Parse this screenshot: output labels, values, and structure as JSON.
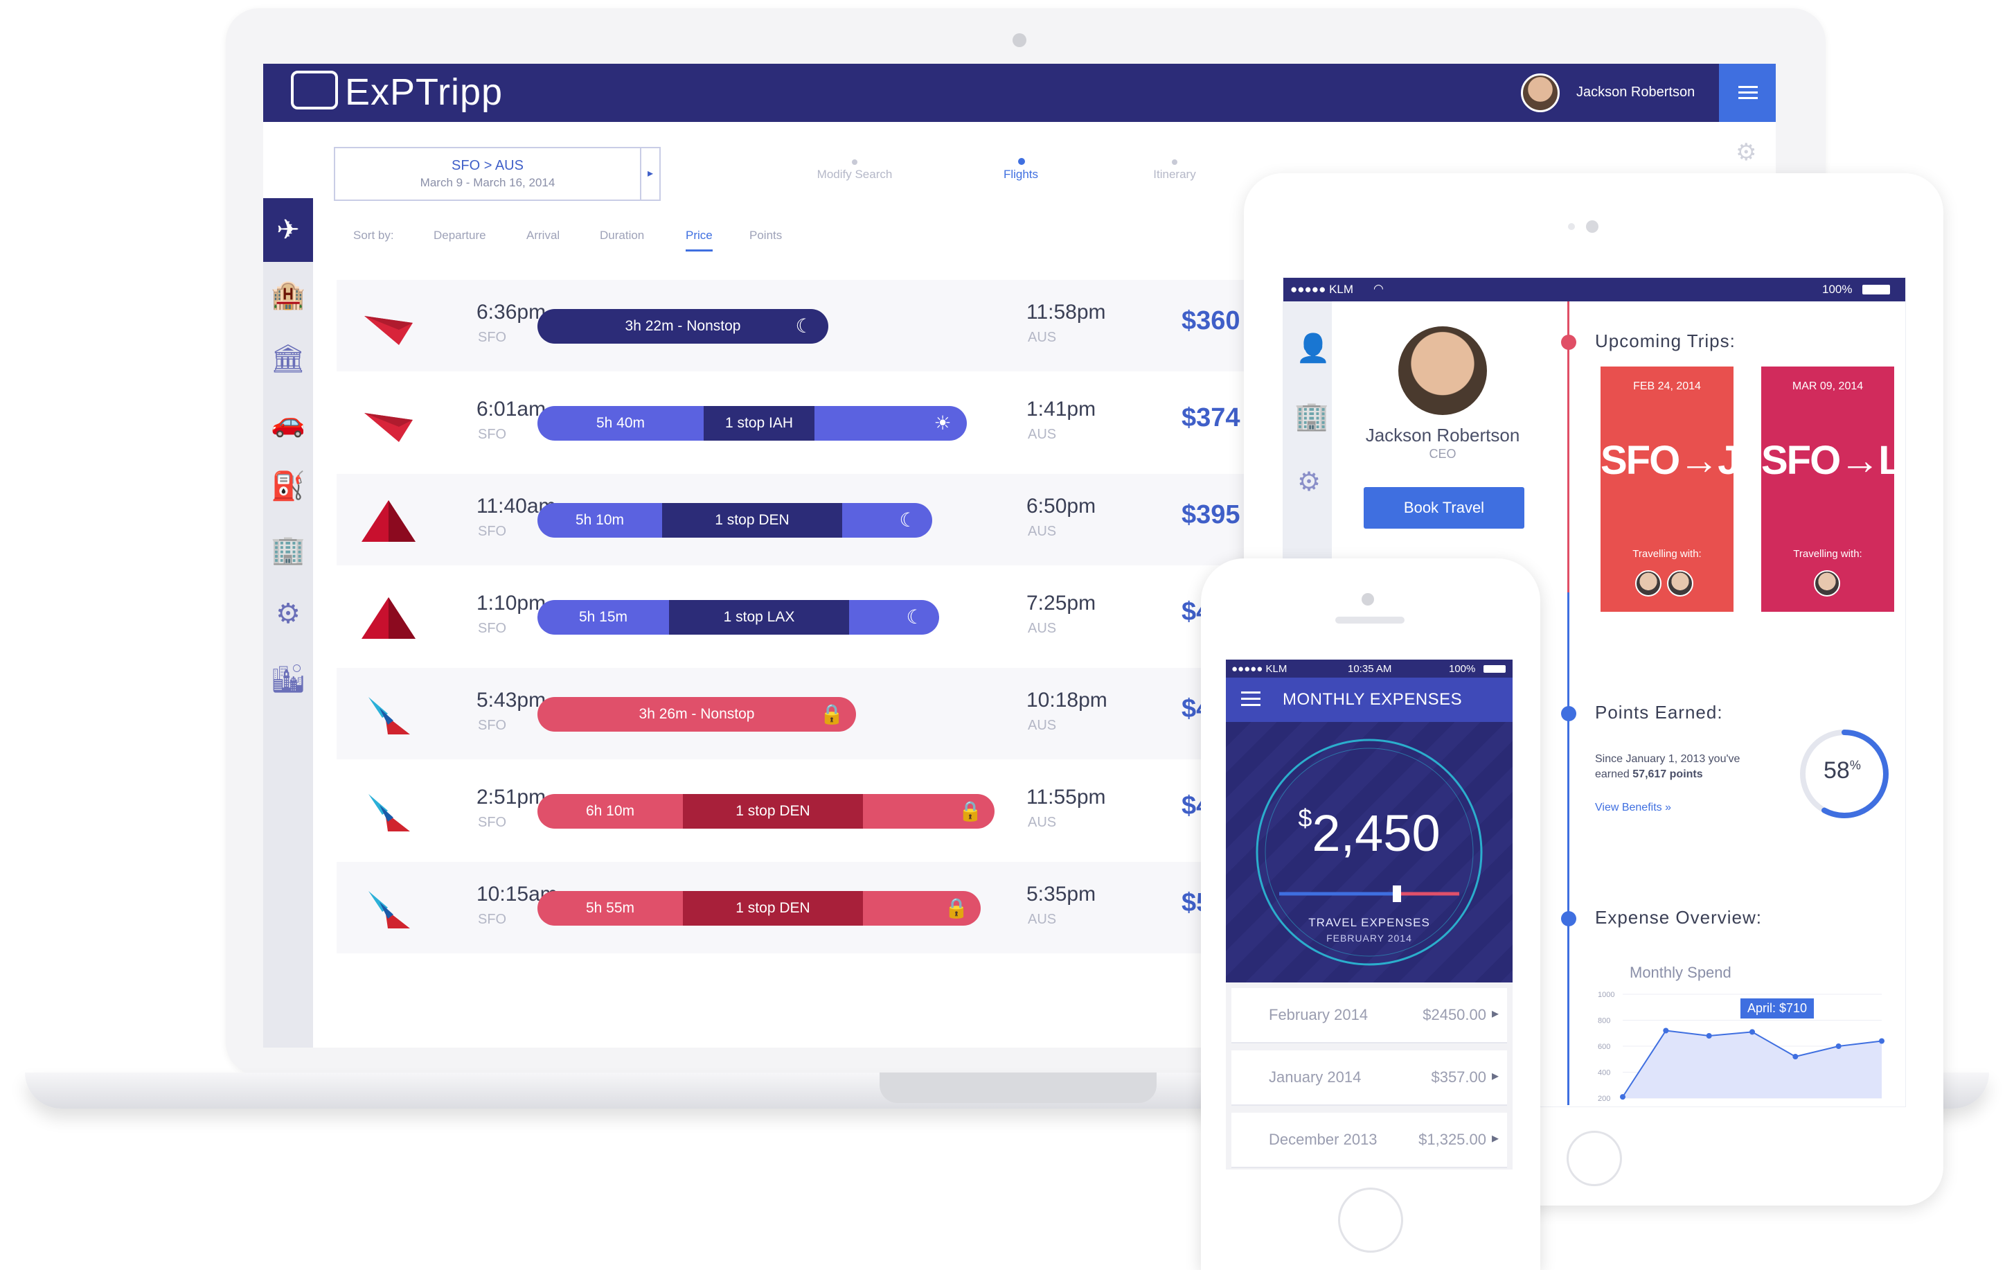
{
  "laptop": {
    "logo": "ExPTripp",
    "user_name": "Jackson Robertson",
    "route": {
      "main": "SFO > AUS",
      "dates": "March 9 - March 16, 2014"
    },
    "steps": [
      "Modify Search",
      "Flights",
      "Itinerary"
    ],
    "active_step": "Flights",
    "sort": {
      "label": "Sort by:",
      "options": [
        "Departure",
        "Arrival",
        "Duration",
        "Price",
        "Points"
      ],
      "active": "Price"
    },
    "flights": [
      {
        "airline": "Virgin America",
        "dep_time": "6:36pm",
        "dep_code": "SFO",
        "bar_segments": [
          "3h 22m - Nonstop"
        ],
        "icon": "moon-icon",
        "color": "#2c2c78",
        "arr_time": "11:58pm",
        "arr_code": "AUS",
        "price": "$360"
      },
      {
        "airline": "Virgin America",
        "dep_time": "6:01am",
        "dep_code": "SFO",
        "bar_segments": [
          "5h 40m",
          "1 stop IAH"
        ],
        "icon": "sun-icon",
        "color": "#5b62e0",
        "arr_time": "1:41pm",
        "arr_code": "AUS",
        "price": "$374"
      },
      {
        "airline": "Delta",
        "dep_time": "11:40am",
        "dep_code": "SFO",
        "bar_segments": [
          "5h 10m",
          "1 stop DEN"
        ],
        "icon": "moon-icon",
        "color": "#5b62e0",
        "arr_time": "6:50pm",
        "arr_code": "AUS",
        "price": "$395"
      },
      {
        "airline": "Delta",
        "dep_time": "1:10pm",
        "dep_code": "SFO",
        "bar_segments": [
          "5h 15m",
          "1 stop LAX"
        ],
        "icon": "moon-icon",
        "color": "#5b62e0",
        "arr_time": "7:25pm",
        "arr_code": "AUS",
        "price": "$4"
      },
      {
        "airline": "American",
        "dep_time": "5:43pm",
        "dep_code": "SFO",
        "bar_segments": [
          "3h 26m - Nonstop"
        ],
        "icon": "lock-icon",
        "color": "#e0506a",
        "arr_time": "10:18pm",
        "arr_code": "AUS",
        "price": "$4"
      },
      {
        "airline": "American",
        "dep_time": "2:51pm",
        "dep_code": "SFO",
        "bar_segments": [
          "6h 10m",
          "1 stop DEN"
        ],
        "icon": "lock-icon",
        "color": "#e0506a",
        "arr_time": "11:55pm",
        "arr_code": "AUS",
        "price": "$4"
      },
      {
        "airline": "American",
        "dep_time": "10:15am",
        "dep_code": "SFO",
        "bar_segments": [
          "5h 55m",
          "1 stop DEN"
        ],
        "icon": "lock-icon",
        "color": "#e0506a",
        "arr_time": "5:35pm",
        "arr_code": "AUS",
        "price": "$5"
      }
    ],
    "side_icons": [
      "plane-icon",
      "hotel-icon",
      "restaurant-icon",
      "car-icon",
      "gas-icon",
      "building-icon",
      "gear-icon",
      "city-icon"
    ]
  },
  "tablet": {
    "status": {
      "carrier": "●●●●● KLM",
      "battery": "100%"
    },
    "profile": {
      "name": "Jackson Robertson",
      "title": "CEO",
      "book_label": "Book Travel"
    },
    "upcoming": {
      "title": "Upcoming Trips:",
      "trips": [
        {
          "date": "FEB 24, 2014",
          "route": "SFO→JFK",
          "with_label": "Travelling with:",
          "color": "#e8504e"
        },
        {
          "date": "MAR 09, 2014",
          "route": "SFO→LHR",
          "with_label": "Travelling with:",
          "color": "#d12b5c"
        }
      ]
    },
    "points": {
      "title": "Points Earned:",
      "line1": "Since January 1, 2013 you've",
      "line2_prefix": "earned ",
      "line2_value": "57,617 points",
      "link": "View Benefits »",
      "percent": 58,
      "percent_label": "58",
      "percent_sign": "%"
    },
    "expense": {
      "title": "Expense Overview:",
      "chart_title": "Monthly Spend",
      "tag": "April: $710"
    }
  },
  "phone": {
    "status": {
      "carrier": "●●●●● KLM",
      "time": "10:35 AM",
      "battery": "100%"
    },
    "title": "MONTHLY EXPENSES",
    "amount_symbol": "$",
    "amount": "2,450",
    "sub1": "TRAVEL EXPENSES",
    "sub2": "FEBRUARY 2014",
    "rows": [
      {
        "month": "February 2014",
        "amount": "$2450.00"
      },
      {
        "month": "January 2014",
        "amount": "$357.00"
      },
      {
        "month": "December 2013",
        "amount": "$1,325.00"
      }
    ]
  },
  "chart_data": {
    "type": "area",
    "title": "Monthly Spend",
    "x": [
      1,
      2,
      3,
      4,
      5,
      6,
      7
    ],
    "values": [
      210,
      720,
      680,
      710,
      520,
      600,
      640
    ],
    "ylim": [
      200,
      1000
    ],
    "annotation": "April: $710",
    "grid": true
  }
}
